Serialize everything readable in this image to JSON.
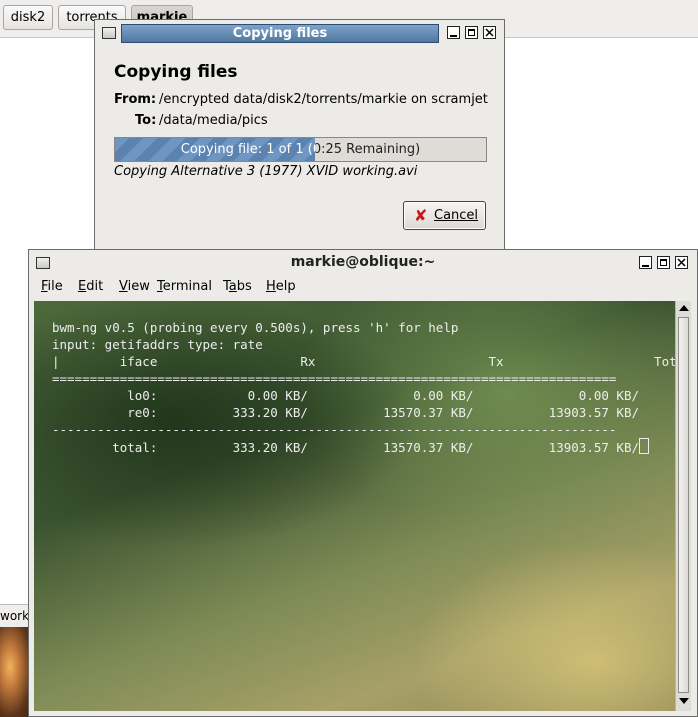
{
  "background": {
    "breadcrumbs": [
      "disk2",
      "torrents",
      "markie"
    ],
    "status_fragment": "worki"
  },
  "copy_dialog": {
    "title": "Copying files",
    "heading": "Copying files",
    "from_label": "From:",
    "from_value": "/encrypted data/disk2/torrents/markie on scramjet",
    "to_label": "To:",
    "to_value": "/data/media/pics",
    "progress_text": "Copying file: 1 of 1 (0:25 Remaining)",
    "progress_fraction": 0.54,
    "current_file": "Copying  Alternative 3 (1977) XVID working.avi",
    "cancel_label": "Cancel",
    "accent_color": "#5b82b0"
  },
  "terminal": {
    "title": "markie@oblique:~",
    "menu": [
      {
        "label": "File",
        "mnemonic": "F"
      },
      {
        "label": "Edit",
        "mnemonic": "E"
      },
      {
        "label": "View",
        "mnemonic": "V"
      },
      {
        "label": "Terminal",
        "mnemonic": "T"
      },
      {
        "label": "Tabs",
        "mnemonic": "a"
      },
      {
        "label": "Help",
        "mnemonic": "H"
      }
    ],
    "lines": [
      "bwm-ng v0.5 (probing every 0.500s), press 'h' for help",
      "input: getifaddrs type: rate",
      "|        iface                   Rx                       Tx                    Total",
      "===========================================================================",
      "          lo0:            0.00 KB/              0.00 KB/              0.00 KB/",
      "          re0:          333.20 KB/          13570.37 KB/          13903.57 KB/",
      "---------------------------------------------------------------------------",
      "        total:          333.20 KB/          13570.37 KB/          13903.57 KB/"
    ]
  }
}
